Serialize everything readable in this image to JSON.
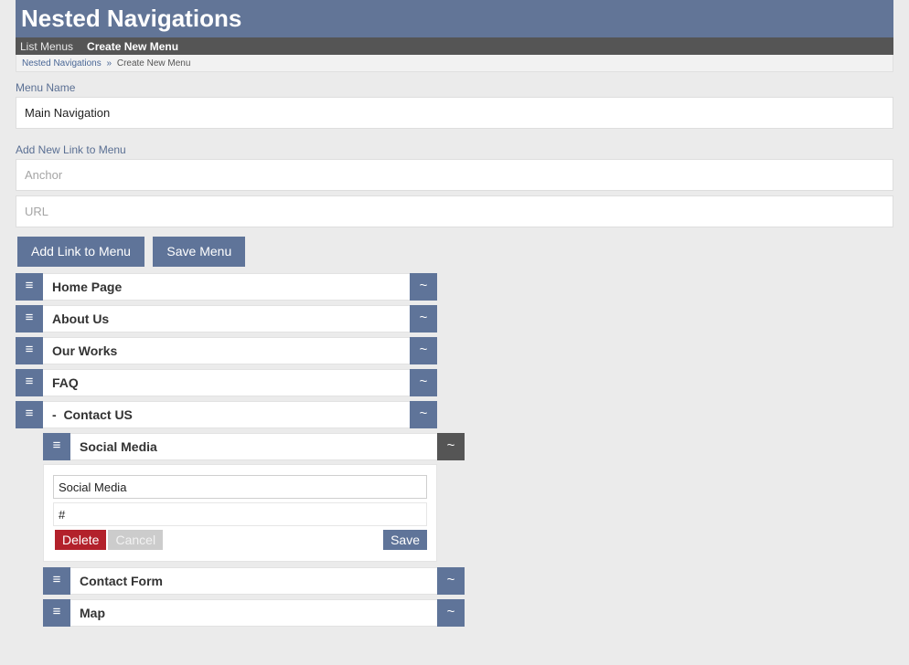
{
  "header": {
    "title": "Nested Navigations"
  },
  "nav": {
    "list_menus": "List Menus",
    "create_new_menu": "Create New Menu"
  },
  "breadcrumb": {
    "home": "Nested Navigations",
    "separator": "»",
    "current": "Create New Menu"
  },
  "form": {
    "menu_name_label": "Menu Name",
    "menu_name_value": "Main Navigation",
    "add_link_label": "Add New Link to Menu",
    "anchor_placeholder": "Anchor",
    "url_placeholder": "URL",
    "add_link_button": "Add Link to Menu",
    "save_menu_button": "Save Menu"
  },
  "icons": {
    "handle": "≡",
    "toggle": "~"
  },
  "menu": {
    "items": [
      {
        "label": "Home Page"
      },
      {
        "label": "About Us"
      },
      {
        "label": "Our Works"
      },
      {
        "label": "FAQ"
      },
      {
        "label": "-  Contact US"
      }
    ],
    "children": [
      {
        "label": "Social Media"
      },
      {
        "label": "Contact Form"
      },
      {
        "label": "Map"
      }
    ]
  },
  "editor": {
    "anchor_value": "Social Media",
    "url_value": "#",
    "delete_button": "Delete",
    "cancel_button": "Cancel",
    "save_button": "Save"
  },
  "colors": {
    "brand": "#627597",
    "nav_bar": "#555555",
    "delete": "#b3212b",
    "cancel": "#cccccc"
  }
}
